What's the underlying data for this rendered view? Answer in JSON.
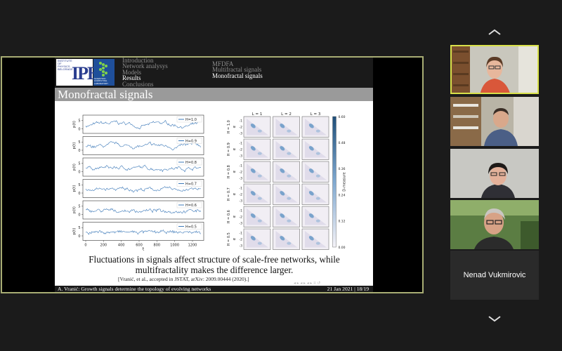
{
  "slide": {
    "logo_ipb_text": "INSTITUTE OF PHYSICS BELGRADE",
    "logo_ipb_mark": "IPB",
    "logo_scl_text": "SCIENTIFIC COMPUTING LABORATORY",
    "nav_left": [
      "Introduction",
      "Network analysys",
      "Models",
      "Results",
      "Conclusions"
    ],
    "nav_left_active": 3,
    "nav_right": [
      "MFDFA",
      "Multifractal signals",
      "Monofractal signals"
    ],
    "nav_right_active": 2,
    "title": "Monofractal signals",
    "caption": "Fluctuations in signals affect structure of scale-free networks, while multifractality makes the difference larger.",
    "reference": "[Vranić, et al., accepted in JSTAT, arXiv: 2009.00444 (2020).]",
    "footer_left": "A. Vranić: Growth signals determine the topology of evolving networks",
    "footer_right": "21 Jan 2021 | 18/19"
  },
  "chart_data": [
    {
      "type": "line",
      "series": [
        {
          "name": "H=1.0"
        },
        {
          "name": "H=0.9"
        },
        {
          "name": "H=0.8"
        },
        {
          "name": "H=0.7"
        },
        {
          "name": "H=0.6"
        },
        {
          "name": "H=0.5"
        }
      ],
      "xlabel": "t",
      "ylabel": "p(t)",
      "xticks": [
        "0",
        "200",
        "400",
        "600",
        "800",
        "1000",
        "1200"
      ],
      "yticks": [
        "5",
        "0"
      ],
      "color": "#3b78b8"
    },
    {
      "type": "heatmap",
      "columns": [
        "L = 1",
        "L = 2",
        "L = 3"
      ],
      "rows": [
        "H = 1.0",
        "H = 0.9",
        "H = 0.8",
        "H = 0.7",
        "H = 0.6",
        "H = 0.5"
      ],
      "ylabel": "α",
      "xlabel": "β",
      "yticks": [
        "-1",
        "-2",
        "-3"
      ],
      "xticks": [
        "1",
        "2",
        "3"
      ],
      "colorbar_label": "D-measure",
      "colorbar_ticks": [
        "0.60",
        "0.48",
        "0.36",
        "0.24",
        "0.12",
        "0.00"
      ]
    }
  ],
  "participants": [
    {
      "name": "",
      "active": true
    },
    {
      "name": "",
      "active": false
    },
    {
      "name": "",
      "active": false
    },
    {
      "name": "",
      "active": false
    },
    {
      "name": "Nenad Vukmirovic",
      "active": false
    }
  ],
  "icons": [
    "chevron-up-icon",
    "chevron-down-icon"
  ]
}
